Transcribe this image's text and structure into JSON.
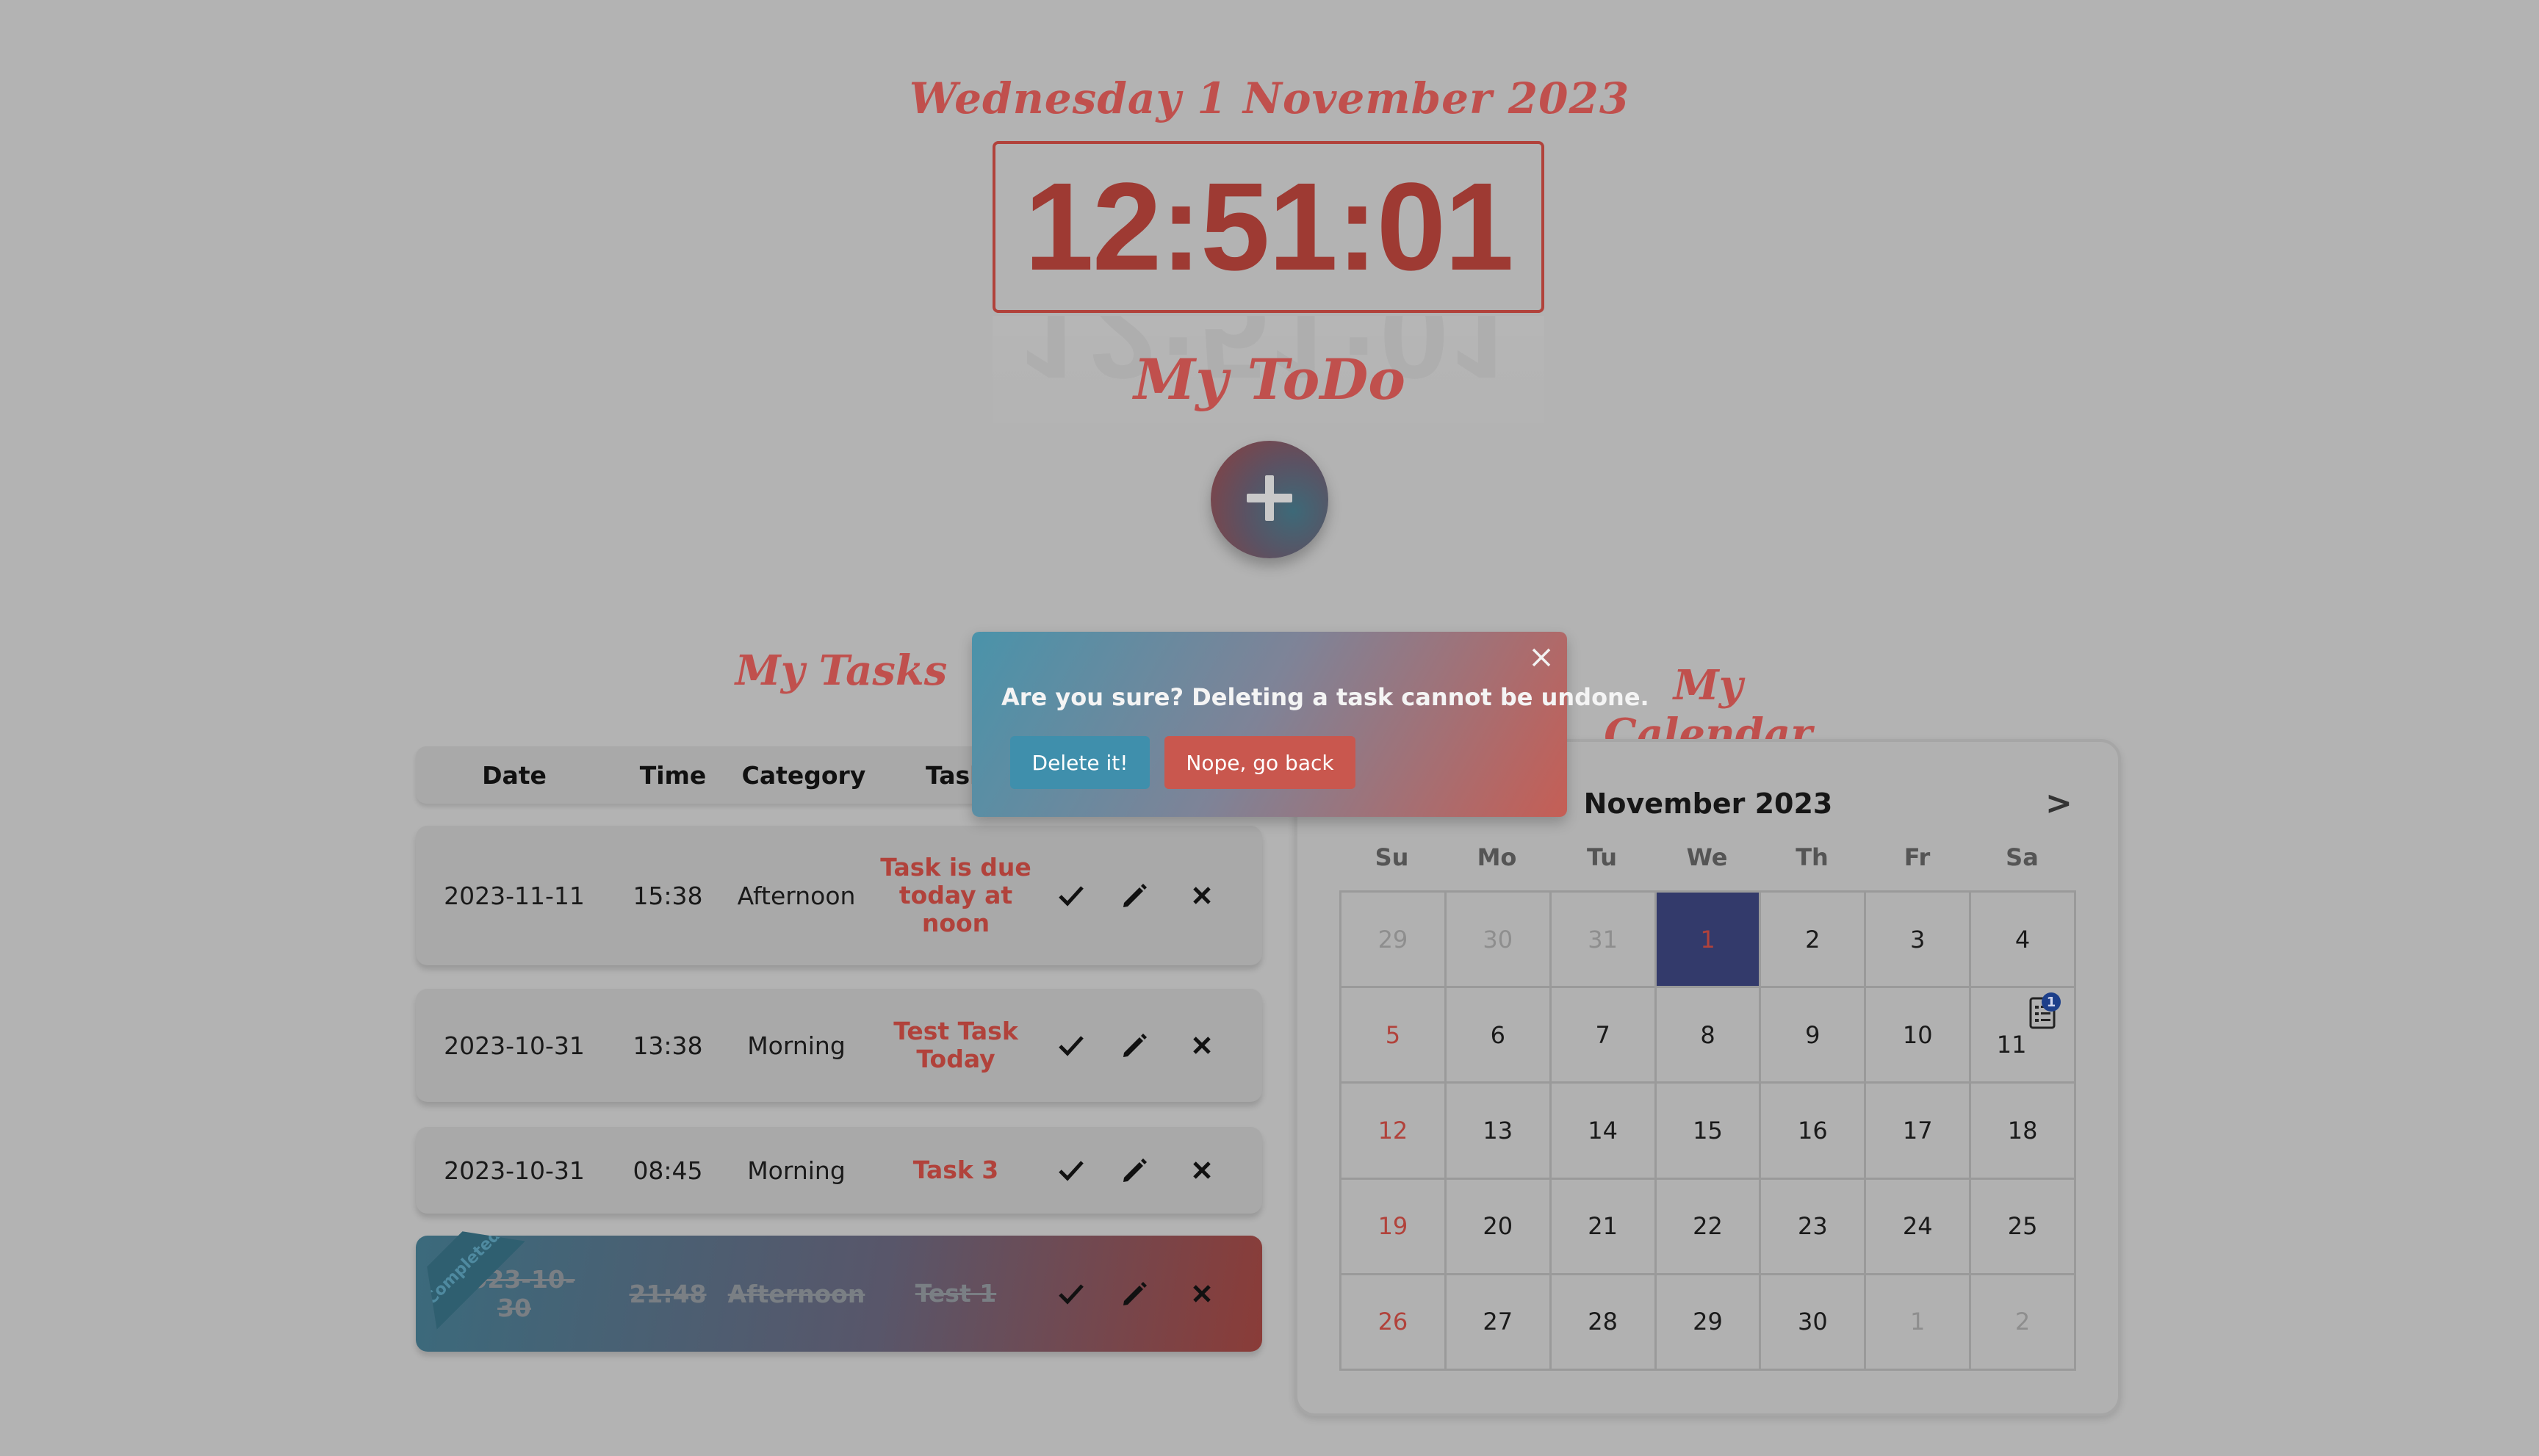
{
  "header": {
    "date_text": "Wednesday 1 November 2023",
    "clock_time": "12:51:01",
    "app_title": "My ToDo"
  },
  "tasks": {
    "title": "My Tasks",
    "columns": [
      "Date",
      "Time",
      "Category",
      "Task"
    ],
    "completed_tag": "Completed",
    "rows": [
      {
        "date": "2023-11-11",
        "time": "15:38",
        "category": "Afternoon",
        "task": "Task is due today at noon",
        "completed": false
      },
      {
        "date": "2023-10-31",
        "time": "13:38",
        "category": "Morning",
        "task": "Test Task Today",
        "completed": false
      },
      {
        "date": "2023-10-31",
        "time": "08:45",
        "category": "Morning",
        "task": "Task 3",
        "completed": false
      },
      {
        "date": "2023-10-30",
        "time": "21:48",
        "category": "Afternoon",
        "task": "Test 1",
        "completed": true
      }
    ]
  },
  "calendar": {
    "title": "My Calendar",
    "month_label": "November 2023",
    "next_label": ">",
    "weekdays": [
      "Su",
      "Mo",
      "Tu",
      "We",
      "Th",
      "Fr",
      "Sa"
    ],
    "weeks": [
      [
        "29",
        "30",
        "31",
        "1",
        "2",
        "3",
        "4"
      ],
      [
        "5",
        "6",
        "7",
        "8",
        "9",
        "10",
        "11"
      ],
      [
        "12",
        "13",
        "14",
        "15",
        "16",
        "17",
        "18"
      ],
      [
        "19",
        "20",
        "21",
        "22",
        "23",
        "24",
        "25"
      ],
      [
        "26",
        "27",
        "28",
        "29",
        "30",
        "1",
        "2"
      ]
    ],
    "note_badge_count": "1"
  },
  "modal": {
    "message": "Are you sure? Deleting a task cannot be undone.",
    "confirm_label": "Delete it!",
    "cancel_label": "Nope, go back"
  },
  "colors": {
    "overlay_bg": "#b3b3b3",
    "accent_red": "#b1423b",
    "today_bg": "#333a6b",
    "modal_blue": "#3f8fac",
    "modal_red": "#c9574e"
  }
}
